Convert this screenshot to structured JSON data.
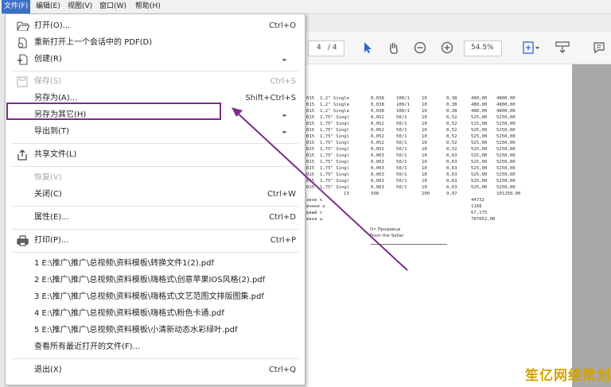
{
  "menubar": {
    "items": [
      {
        "label": "文件(F)"
      },
      {
        "label": "编辑(E)"
      },
      {
        "label": "视图(V)"
      },
      {
        "label": "窗口(W)"
      },
      {
        "label": "帮助(H)"
      }
    ]
  },
  "toolbar": {
    "page_current": "4",
    "page_total": "/ 4",
    "zoom": "54.5%"
  },
  "file_menu": {
    "open": {
      "label": "打开(O)...",
      "shortcut": "Ctrl+O"
    },
    "reopen": {
      "label": "重新打开上一个会话中的 PDF(D)"
    },
    "create": {
      "label": "创建(R)"
    },
    "save": {
      "label": "保存(S)",
      "shortcut": "Ctrl+S"
    },
    "save_as": {
      "label": "另存为(A)...",
      "shortcut": "Shift+Ctrl+S"
    },
    "save_as_other": {
      "label": "另存为其它(H)"
    },
    "export_to": {
      "label": "导出到(T)"
    },
    "share": {
      "label": "共享文件(L)"
    },
    "revert": {
      "label": "恢复(V)"
    },
    "close": {
      "label": "关闭(C)",
      "shortcut": "Ctrl+W"
    },
    "properties": {
      "label": "属性(E)...",
      "shortcut": "Ctrl+D"
    },
    "print": {
      "label": "打印(P)...",
      "shortcut": "Ctrl+P"
    },
    "recent": [
      {
        "label": "1 E:\\推广\\推广\\总视频\\资料模板\\转换文件1(2).pdf"
      },
      {
        "label": "2 E:\\推广\\推广\\总视频\\资料模板\\嗨格式\\创意苹果IOS风格(2).pdf"
      },
      {
        "label": "3 E:\\推广\\推广\\总视频\\资料模板\\嗨格式\\文艺范图文排版图集.pdf"
      },
      {
        "label": "4 E:\\推广\\推广\\总视频\\资料模板\\嗨格式\\粉色卡通.pdf"
      },
      {
        "label": "5 E:\\推广\\推广\\总视频\\资料模板\\小清新动态水彩绿叶.pdf"
      }
    ],
    "view_all_recent": {
      "label": "查看所有最近打开的文件(F)..."
    },
    "exit": {
      "label": "退出(X)",
      "shortcut": "Ctrl+Q"
    }
  },
  "document": {
    "rows": [
      [
        "015",
        "1,2\" Single",
        "0,038",
        "100/1",
        "10",
        "0,38",
        "480,00",
        "4800,00"
      ],
      [
        "015",
        "1,2\" Single",
        "0,038",
        "100/1",
        "10",
        "0,38",
        "480,00",
        "4800,00"
      ],
      [
        "015",
        "1,2\" Single",
        "0,038",
        "100/1",
        "10",
        "0,38",
        "480,00",
        "4800,00"
      ],
      [
        "015",
        "1,75\" Singl",
        "0,052",
        "50/1",
        "10",
        "0,52",
        "525,00",
        "5250,00"
      ],
      [
        "015",
        "1,75\" Singl",
        "0,052",
        "50/1",
        "10",
        "0,52",
        "525,00",
        "5250,00"
      ],
      [
        "015",
        "1,75\" Singl",
        "0,052",
        "50/1",
        "10",
        "0,52",
        "525,00",
        "5250,00"
      ],
      [
        "015",
        "1,75\" Singl",
        "0,052",
        "50/1",
        "10",
        "0,52",
        "525,00",
        "5250,00"
      ],
      [
        "015",
        "1,75\" Singl",
        "0,052",
        "50/1",
        "10",
        "0,52",
        "525,00",
        "5250,00"
      ],
      [
        "015",
        "1,75\" Singl",
        "0,052",
        "50/1",
        "10",
        "0,52",
        "525,00",
        "5250,00"
      ],
      [
        "015",
        "1,75\" Singl",
        "0,063",
        "50/1",
        "10",
        "0,63",
        "525,00",
        "5250,00"
      ],
      [
        "015",
        "1,75\" Singl",
        "0,063",
        "50/1",
        "10",
        "0,63",
        "525,00",
        "5250,00"
      ],
      [
        "015",
        "1,75\" Singl",
        "0,063",
        "50/1",
        "10",
        "0,63",
        "525,00",
        "5250,00"
      ],
      [
        "015",
        "1,75\" Singl",
        "0,063",
        "50/1",
        "10",
        "0,63",
        "525,00",
        "5250,00"
      ],
      [
        "015",
        "1,75\" Singl",
        "0,063",
        "50/1",
        "10",
        "0,63",
        "525,00",
        "5250,00"
      ],
      [
        "015",
        "1,75\" Singl",
        "0,063",
        "50/1",
        "10",
        "0,63",
        "525,00",
        "5250,00"
      ]
    ],
    "total_row": [
      "13",
      "500",
      "",
      "200",
      "9,97",
      "",
      "101250,00"
    ],
    "summary": [
      {
        "left": "эвое к",
        "right": "44732"
      },
      {
        "left": "ичное к",
        "right": "1168"
      },
      {
        "left": "рвый с",
        "right": "67,175"
      },
      {
        "left": "ввая ц",
        "right": "707052,00"
      }
    ],
    "seller_1": "От Продавца",
    "seller_2": "From the Seller"
  },
  "watermark": "笙亿网络策划",
  "colors": {
    "highlight": "#7b2d8b",
    "menu_active": "#3d6fc4"
  }
}
